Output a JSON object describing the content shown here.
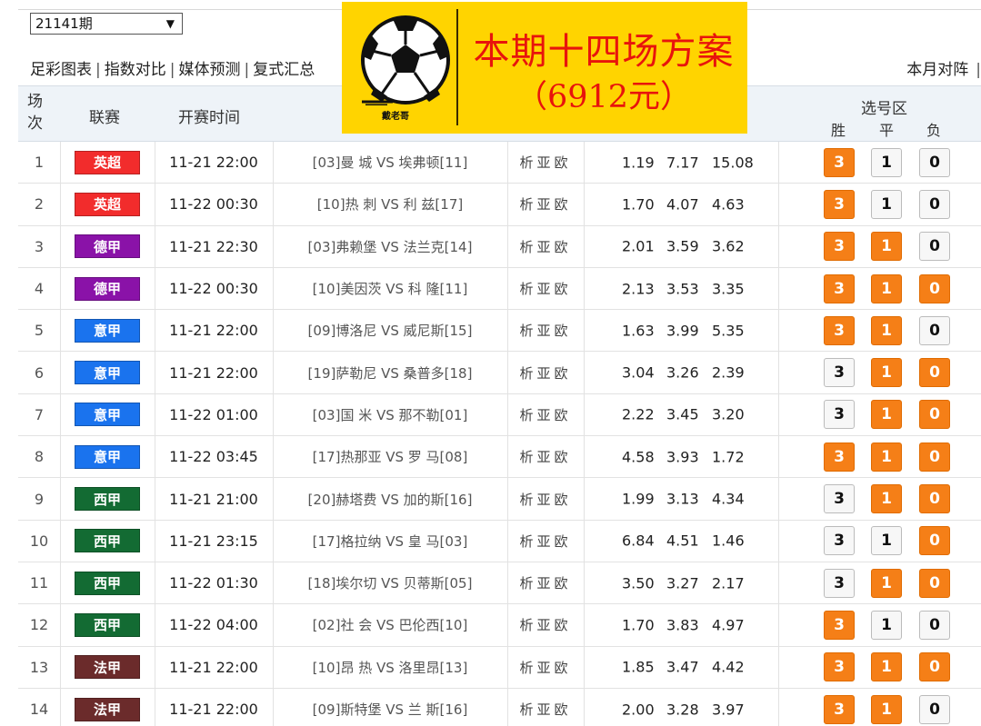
{
  "period": "21141期",
  "nav": {
    "left": [
      "足彩图表",
      "指数对比",
      "媒体预测",
      "复式汇总"
    ],
    "right": "本月对阵"
  },
  "header": {
    "no": "场\n次",
    "league": "联赛",
    "time": "开赛时间",
    "pick_zone": "选号区",
    "win": "胜",
    "draw": "平",
    "lose": "负"
  },
  "banner": {
    "brand": "戴老哥",
    "title": "本期十四场方案",
    "amount": "（6912元）",
    "color": "#ffd400"
  },
  "colors": {
    "英超": "#f22c2c",
    "德甲": "#8a12a8",
    "意甲": "#1a73ee",
    "西甲": "#136b33",
    "法甲": "#6b2b2b",
    "pick_on": "#f57f17"
  },
  "rows": [
    {
      "no": "1",
      "league": "英超",
      "time": "11-21 22:00",
      "match": "[03]曼 城 VS 埃弗顿[11]",
      "links": "析亚欧",
      "odds": [
        "1.19",
        "7.17",
        "15.08"
      ],
      "w": "3",
      "d": "1",
      "l": "0",
      "picks": [
        true,
        false,
        false
      ]
    },
    {
      "no": "2",
      "league": "英超",
      "time": "11-22 00:30",
      "match": "[10]热 刺 VS 利 兹[17]",
      "links": "析亚欧",
      "odds": [
        "1.70",
        "4.07",
        "4.63"
      ],
      "w": "3",
      "d": "1",
      "l": "0",
      "picks": [
        true,
        false,
        false
      ]
    },
    {
      "no": "3",
      "league": "德甲",
      "time": "11-21 22:30",
      "match": "[03]弗赖堡 VS 法兰克[14]",
      "links": "析亚欧",
      "odds": [
        "2.01",
        "3.59",
        "3.62"
      ],
      "w": "3",
      "d": "1",
      "l": "0",
      "picks": [
        true,
        true,
        false
      ]
    },
    {
      "no": "4",
      "league": "德甲",
      "time": "11-22 00:30",
      "match": "[10]美因茨 VS 科 隆[11]",
      "links": "析亚欧",
      "odds": [
        "2.13",
        "3.53",
        "3.35"
      ],
      "w": "3",
      "d": "1",
      "l": "0",
      "picks": [
        true,
        true,
        true
      ]
    },
    {
      "no": "5",
      "league": "意甲",
      "time": "11-21 22:00",
      "match": "[09]博洛尼 VS 威尼斯[15]",
      "links": "析亚欧",
      "odds": [
        "1.63",
        "3.99",
        "5.35"
      ],
      "w": "3",
      "d": "1",
      "l": "0",
      "picks": [
        true,
        true,
        false
      ]
    },
    {
      "no": "6",
      "league": "意甲",
      "time": "11-21 22:00",
      "match": "[19]萨勒尼 VS 桑普多[18]",
      "links": "析亚欧",
      "odds": [
        "3.04",
        "3.26",
        "2.39"
      ],
      "w": "3",
      "d": "1",
      "l": "0",
      "picks": [
        false,
        true,
        true
      ]
    },
    {
      "no": "7",
      "league": "意甲",
      "time": "11-22 01:00",
      "match": "[03]国 米 VS 那不勒[01]",
      "links": "析亚欧",
      "odds": [
        "2.22",
        "3.45",
        "3.20"
      ],
      "w": "3",
      "d": "1",
      "l": "0",
      "picks": [
        false,
        true,
        true
      ]
    },
    {
      "no": "8",
      "league": "意甲",
      "time": "11-22 03:45",
      "match": "[17]热那亚 VS 罗 马[08]",
      "links": "析亚欧",
      "odds": [
        "4.58",
        "3.93",
        "1.72"
      ],
      "w": "3",
      "d": "1",
      "l": "0",
      "picks": [
        true,
        true,
        true
      ]
    },
    {
      "no": "9",
      "league": "西甲",
      "time": "11-21 21:00",
      "match": "[20]赫塔费 VS 加的斯[16]",
      "links": "析亚欧",
      "odds": [
        "1.99",
        "3.13",
        "4.34"
      ],
      "w": "3",
      "d": "1",
      "l": "0",
      "picks": [
        false,
        true,
        true
      ]
    },
    {
      "no": "10",
      "league": "西甲",
      "time": "11-21 23:15",
      "match": "[17]格拉纳 VS 皇 马[03]",
      "links": "析亚欧",
      "odds": [
        "6.84",
        "4.51",
        "1.46"
      ],
      "w": "3",
      "d": "1",
      "l": "0",
      "picks": [
        false,
        false,
        true
      ]
    },
    {
      "no": "11",
      "league": "西甲",
      "time": "11-22 01:30",
      "match": "[18]埃尔切 VS 贝蒂斯[05]",
      "links": "析亚欧",
      "odds": [
        "3.50",
        "3.27",
        "2.17"
      ],
      "w": "3",
      "d": "1",
      "l": "0",
      "picks": [
        false,
        true,
        true
      ]
    },
    {
      "no": "12",
      "league": "西甲",
      "time": "11-22 04:00",
      "match": "[02]社 会 VS 巴伦西[10]",
      "links": "析亚欧",
      "odds": [
        "1.70",
        "3.83",
        "4.97"
      ],
      "w": "3",
      "d": "1",
      "l": "0",
      "picks": [
        true,
        false,
        false
      ]
    },
    {
      "no": "13",
      "league": "法甲",
      "time": "11-21 22:00",
      "match": "[10]昂 热 VS 洛里昂[13]",
      "links": "析亚欧",
      "odds": [
        "1.85",
        "3.47",
        "4.42"
      ],
      "w": "3",
      "d": "1",
      "l": "0",
      "picks": [
        true,
        true,
        true
      ]
    },
    {
      "no": "14",
      "league": "法甲",
      "time": "11-21 22:00",
      "match": "[09]斯特堡 VS 兰 斯[16]",
      "links": "析亚欧",
      "odds": [
        "2.00",
        "3.28",
        "3.97"
      ],
      "w": "3",
      "d": "1",
      "l": "0",
      "picks": [
        true,
        true,
        false
      ]
    }
  ]
}
